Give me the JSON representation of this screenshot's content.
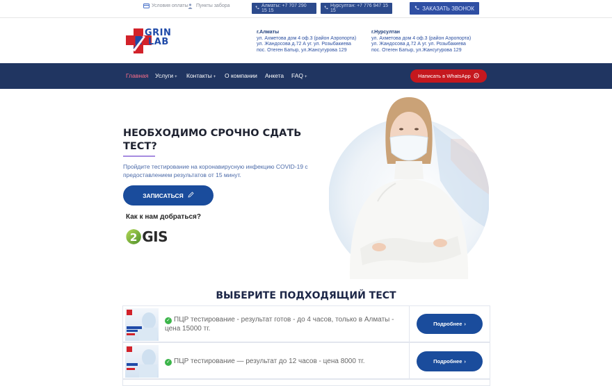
{
  "topbar": {
    "payment_label": "Условия оплаты",
    "pickup_label": "Пункты забора",
    "phone_almaty": "Алматы: +7 707 290 15 15",
    "phone_nursultan": "Нурсултан: +7 776 947 15 15",
    "call_label": "ЗАКАЗАТЬ ЗВОНОК"
  },
  "logo": {
    "top": "GRIN",
    "bottom": "LAB"
  },
  "addresses": [
    {
      "city": "г.Алматы",
      "lines": [
        "ул. Ахметова дом 4 оф.3 (район Аэропорта)",
        "ул. Жандосова д.72 А уг. ул. Розыбакиева",
        "пос. Отеген Батыр, ул.Жансугурова 129"
      ]
    },
    {
      "city": "г.Нурсултан",
      "lines": [
        "ул. Ахметова дом 4 оф.3 (район Аэропорта)",
        "ул. Жандосова д.72 А уг. ул. Розыбакиева",
        "пос. Отеген Батыр, ул.Жансугурова 129"
      ]
    }
  ],
  "nav": {
    "items": [
      "Главная",
      "Услуги",
      "Контакты",
      "О компании",
      "Анкета",
      "FAQ"
    ],
    "whatsapp_label": "Написать в WhatsApp"
  },
  "hero": {
    "title": "НЕОБХОДИМО СРОЧНО СДАТЬ ТЕСТ?",
    "subtitle": "Пройдите тестирование на коронавирусную инфекцию COVID-19 с предоставлением результатов от 15 минут.",
    "signup_label": "ЗАПИСАТЬСЯ",
    "howto_label": "Как к нам добраться?",
    "gis_label": "GIS"
  },
  "tests": {
    "section_title": "ВЫБЕРИТЕ ПОДХОДЯЩИЙ ТЕСТ",
    "items": [
      {
        "text": "ПЦР тестирование - результат готов - до 4 часов, только в Алматы - цена 15000 тг.",
        "more_label": "Подробнее",
        "thumb_label": "УСКОРЕННЫЙ ПЦР ТЕСТ"
      },
      {
        "text": "ПЦР тестирование — результат до 12 часов - цена 8000 тг.",
        "more_label": "Подробнее",
        "thumb_label": "ПЦР ТЕСТ"
      }
    ]
  },
  "colors": {
    "nav_bg": "#203561",
    "accent_blue": "#1a4c9c",
    "whatsapp_red": "#c5181e",
    "active_nav": "#ff6f8a"
  }
}
